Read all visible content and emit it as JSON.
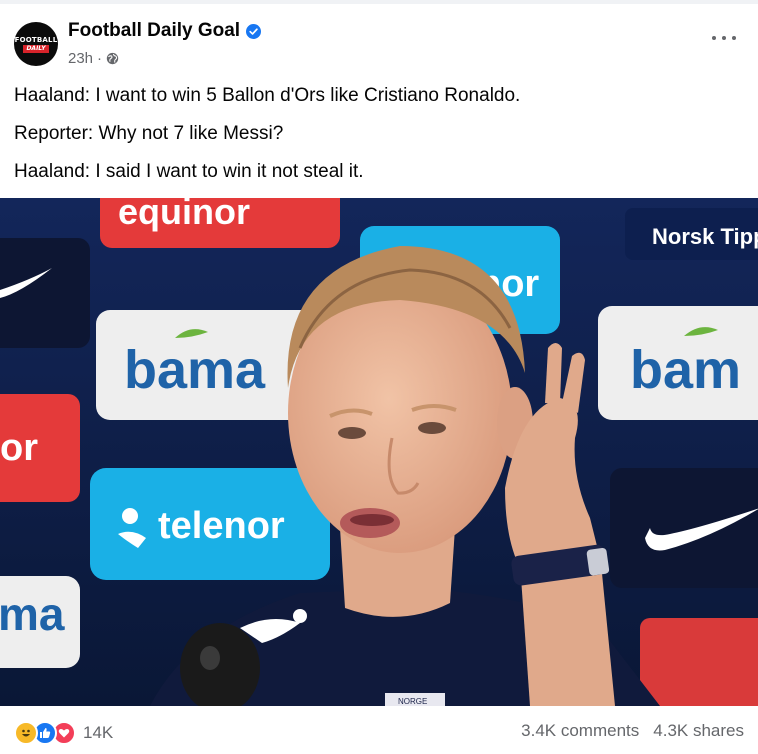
{
  "post": {
    "page_name": "Football Daily Goal",
    "avatar": {
      "line1": "FOOTBALL",
      "line2": "DAILY"
    },
    "timestamp": "23h",
    "separator": "·",
    "verified_icon": "verified-badge-icon",
    "privacy_icon": "globe-icon",
    "more_icon": "more-options-icon",
    "lines": [
      "Haaland: I want to win 5 Ballon d'Ors like Cristiano Ronaldo.",
      "Reporter: Why not 7 like Messi?",
      "Haaland: I said I want to win it not steal it."
    ]
  },
  "photo": {
    "sponsor_texts": [
      "equinor",
      "Norsk Tipp",
      "nor",
      "bama",
      "bam",
      "telenor",
      "ma",
      "or"
    ],
    "shirt_text": "NORGE"
  },
  "footer": {
    "reaction_count": "14K",
    "comments": "3.4K comments",
    "shares": "4.3K shares"
  },
  "colors": {
    "accent": "#1877f2",
    "secondary_text": "#65676b",
    "banner_background": "#0c1a3e"
  }
}
